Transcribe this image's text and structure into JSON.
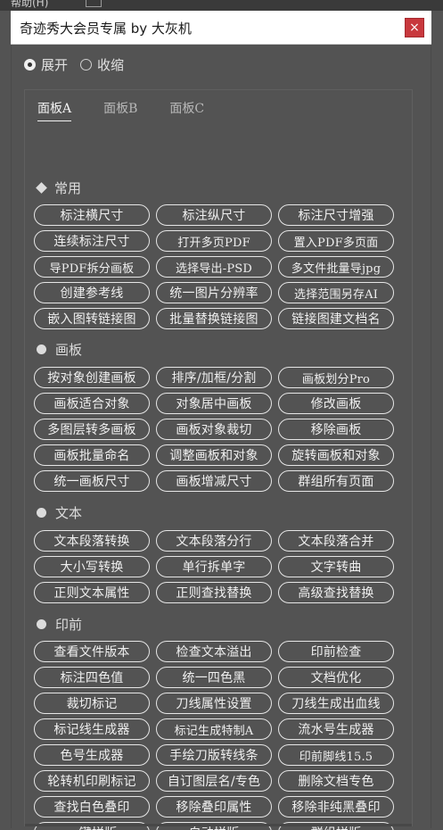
{
  "window": {
    "behind_text": "帮助(H)",
    "title": "奇迹秀大会员专属 by 大灰机",
    "close_glyph": "×"
  },
  "mode": {
    "expand_label": "展开",
    "collapse_label": "收缩",
    "selected": "expand"
  },
  "tabs": [
    {
      "label": "面板A",
      "active": true
    },
    {
      "label": "面板B",
      "active": false
    },
    {
      "label": "面板C",
      "active": false
    }
  ],
  "sections": [
    {
      "title": "常用",
      "icon": "diamond-icon",
      "buttons": [
        "标注横尺寸",
        "标注纵尺寸",
        "标注尺寸增强",
        "连续标注尺寸",
        "打开多页PDF",
        "置入PDF多页面",
        "导PDF拆分画板",
        "选择导出-PSD",
        "多文件批量导jpg",
        "创建参考线",
        "统一图片分辨率",
        "选择范围另存AI",
        "嵌入图转链接图",
        "批量替换链接图",
        "链接图建文档名"
      ]
    },
    {
      "title": "画板",
      "icon": "dot-icon",
      "buttons": [
        "按对象创建画板",
        "排序/加框/分割",
        "画板划分Pro",
        "画板适合对象",
        "对象居中画板",
        "修改画板",
        "多图层转多画板",
        "画板对象裁切",
        "移除画板",
        "画板批量命名",
        "调整画板和对象",
        "旋转画板和对象",
        "统一画板尺寸",
        "画板增减尺寸",
        "群组所有页面"
      ]
    },
    {
      "title": "文本",
      "icon": "dot-icon",
      "buttons": [
        "文本段落转换",
        "文本段落分行",
        "文本段落合并",
        "大小写转换",
        "单行拆单字",
        "文字转曲",
        "正则文本属性",
        "正则查找替换",
        "高级查找替换"
      ]
    },
    {
      "title": "印前",
      "icon": "dot-icon",
      "buttons": [
        "查看文件版本",
        "检查文本溢出",
        "印前检查",
        "标注四色值",
        "统一四色黑",
        "文档优化",
        "裁切标记",
        "刀线属性设置",
        "刀线生成出血线",
        "标记线生成器",
        "标记生成特制A",
        "流水号生成器",
        "色号生成器",
        "手绘刀版转线条",
        "印前脚线15.5",
        "轮转机印刷标记",
        "自订图层名/专色",
        "删除文档专色",
        "查找白色叠印",
        "移除叠印属性",
        "移除非纯黑叠印",
        "一键拼版",
        "自动拼版",
        "群组拼版"
      ]
    }
  ]
}
